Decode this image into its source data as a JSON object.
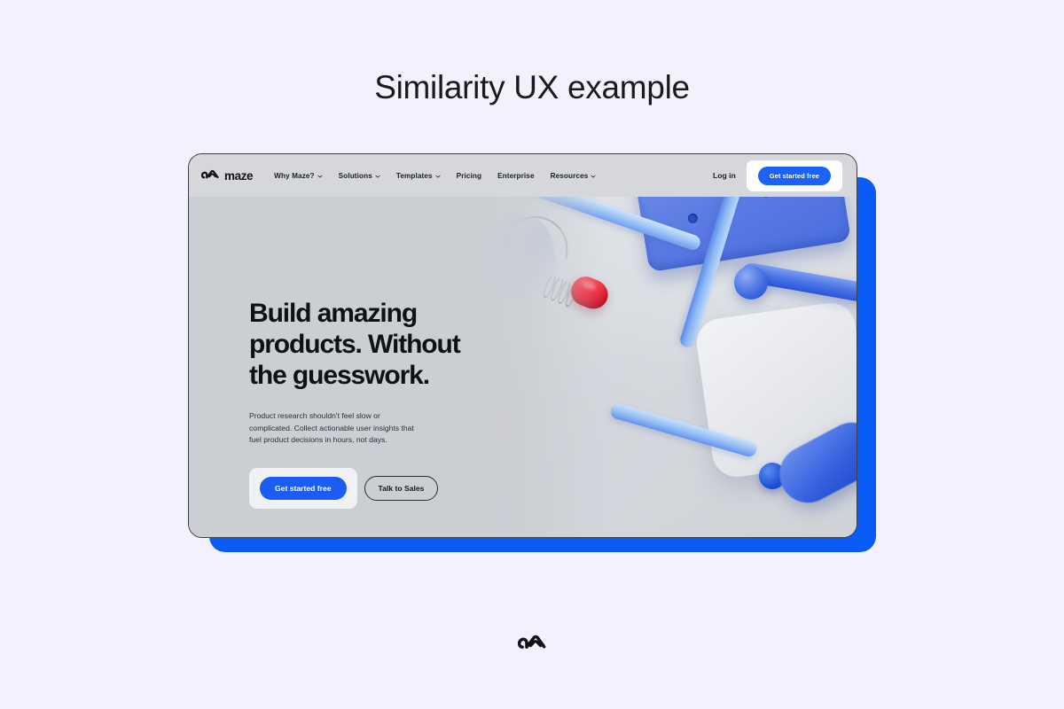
{
  "page": {
    "title": "Similarity UX example",
    "background_color": "#f3f1fd"
  },
  "colors": {
    "accent_blue": "#1b5cf2",
    "offset_card_blue": "#0b5cf6",
    "hero_grey": "#cbced3",
    "header_grey": "#d5d7db",
    "text_dark": "#101116"
  },
  "mockup": {
    "brand": {
      "logo_icon": "maze-arch-logo-icon",
      "wordmark": "maze"
    },
    "nav": [
      {
        "label": "Why Maze?",
        "has_dropdown": true
      },
      {
        "label": "Solutions",
        "has_dropdown": true
      },
      {
        "label": "Templates",
        "has_dropdown": true
      },
      {
        "label": "Pricing",
        "has_dropdown": false
      },
      {
        "label": "Enterprise",
        "has_dropdown": false
      },
      {
        "label": "Resources",
        "has_dropdown": true
      }
    ],
    "header_actions": {
      "login_label": "Log in",
      "cta_label": "Get started free"
    },
    "hero": {
      "headline_line1": "Build amazing",
      "headline_line2": "products. Without",
      "headline_line3": "the guesswork.",
      "subheading": "Product research shouldn't feel slow or complicated. Collect actionable user insights that fuel product decisions in hours, not days.",
      "primary_cta": "Get started free",
      "secondary_cta": "Talk to Sales",
      "artwork": "3d-abstract-maze-tubes-red-capsule-illustration"
    }
  },
  "footer": {
    "logo_icon": "maze-arch-logo-icon"
  }
}
